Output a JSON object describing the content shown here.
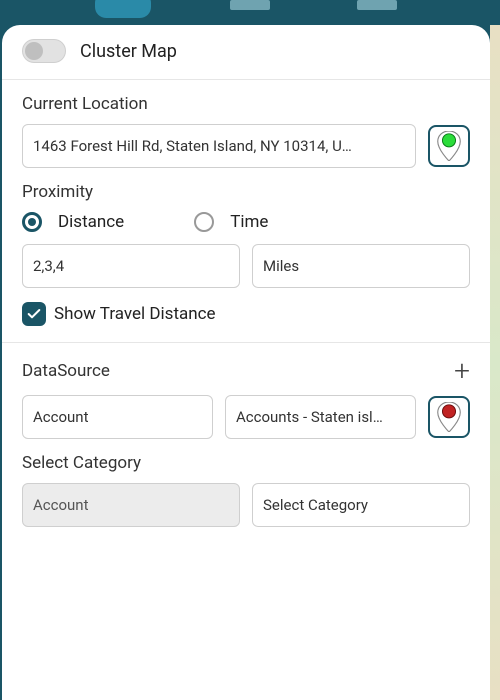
{
  "toggle": {
    "cluster_map_label": "Cluster Map"
  },
  "location": {
    "label": "Current Location",
    "value": "1463 Forest Hill Rd, Staten Island, NY 10314, U…",
    "pin_color": "#2bdc3a"
  },
  "proximity": {
    "label": "Proximity",
    "options": {
      "distance": "Distance",
      "time": "Time"
    },
    "distance_value": "2,3,4",
    "unit_value": "Miles",
    "show_travel_label": "Show Travel Distance"
  },
  "datasource": {
    "label": "DataSource",
    "source_value": "Account",
    "view_value": "Accounts - Staten isl…",
    "pin_color": "#c02222"
  },
  "category": {
    "label": "Select Category",
    "field_value": "Account",
    "selector_value": "Select Category"
  }
}
